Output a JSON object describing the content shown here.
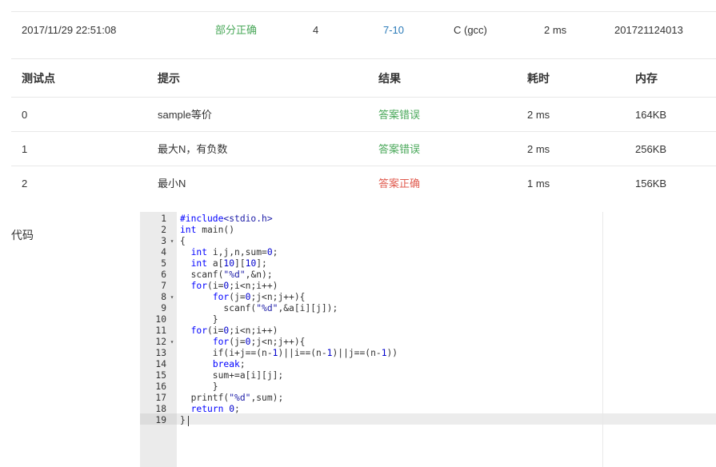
{
  "submission": {
    "time": "2017/11/29 22:51:08",
    "status": "部分正确",
    "score": "4",
    "problem": "7-10",
    "compiler": "C (gcc)",
    "duration": "2 ms",
    "user": "201721124013"
  },
  "table": {
    "headers": [
      "测试点",
      "提示",
      "结果",
      "耗时",
      "内存"
    ],
    "rows": [
      {
        "case": "0",
        "hint": "sample等价",
        "result": "答案错误",
        "time": "2 ms",
        "memory": "164KB"
      },
      {
        "case": "1",
        "hint": "最大N，有负数",
        "result": "答案错误",
        "time": "2 ms",
        "memory": "256KB"
      },
      {
        "case": "2",
        "hint": "最小N",
        "result": "答案正确",
        "time": "1 ms",
        "memory": "156KB"
      }
    ]
  },
  "colors": {
    "correct": "#e05b4f",
    "wrong": "#4aa85a"
  },
  "code": {
    "label": "代码",
    "lines": [
      "#include<stdio.h>",
      "int main()",
      "{",
      "  int i,j,n,sum=0;",
      "  int a[10][10];",
      "  scanf(\"%d\",&n);",
      "  for(i=0;i<n;i++)",
      "      for(j=0;j<n;j++){",
      "        scanf(\"%d\",&a[i][j]);",
      "      }",
      "  for(i=0;i<n;i++)",
      "      for(j=0;j<n;j++){",
      "      if(i+j==(n-1)||i==(n-1)||j==(n-1))",
      "      break;",
      "      sum+=a[i][j];",
      "      }",
      "  printf(\"%d\",sum);",
      "  return 0;",
      "}"
    ],
    "fold_lines": [
      3,
      8,
      12
    ],
    "active_line": 19
  }
}
